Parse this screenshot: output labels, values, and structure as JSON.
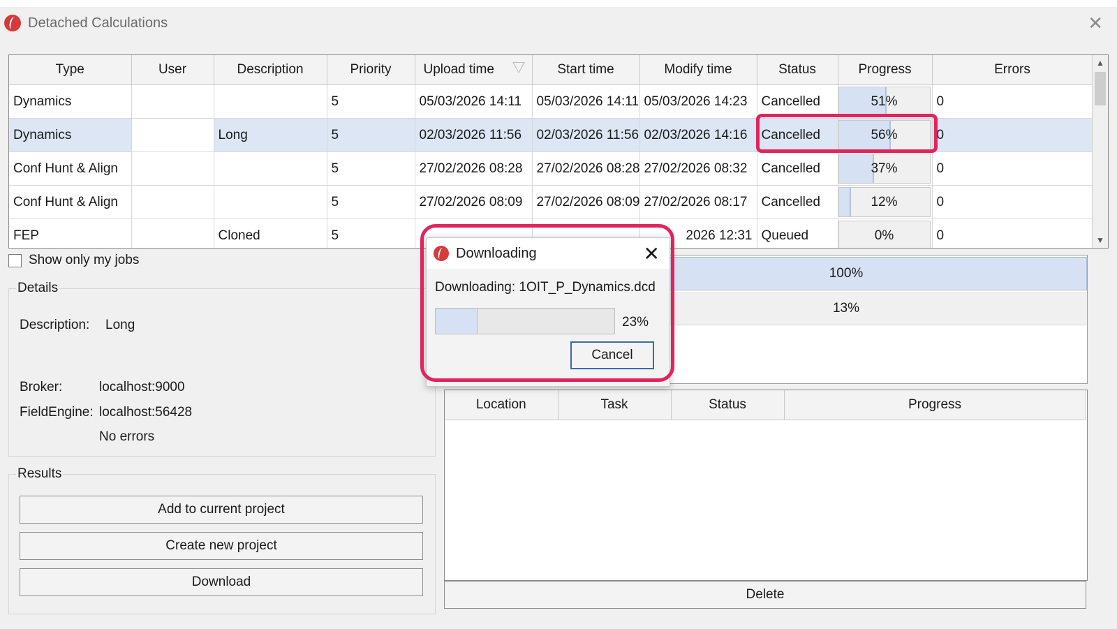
{
  "window": {
    "title": "Detached Calculations",
    "close_glyph": "✕"
  },
  "grid": {
    "columns": [
      "Type",
      "User",
      "Description",
      "Priority",
      "Upload time",
      "Start time",
      "Modify time",
      "Status",
      "Progress",
      "Errors"
    ],
    "rows": [
      {
        "type": "Dynamics",
        "user": "",
        "description": "",
        "priority": "5",
        "upload": "05/03/2026 14:11",
        "start": "05/03/2026 14:11",
        "modify": "05/03/2026 14:23",
        "status": "Cancelled",
        "progress_label": "51%",
        "progress": 51,
        "errors": "0"
      },
      {
        "type": "Dynamics",
        "user": "",
        "description": "Long",
        "priority": "5",
        "upload": "02/03/2026 11:56",
        "start": "02/03/2026 11:56",
        "modify": "02/03/2026 14:16",
        "status": "Cancelled",
        "progress_label": "56%",
        "progress": 56,
        "errors": "0"
      },
      {
        "type": "Conf Hunt & Align",
        "user": "",
        "description": "",
        "priority": "5",
        "upload": "27/02/2026 08:28",
        "start": "27/02/2026 08:28",
        "modify": "27/02/2026 08:32",
        "status": "Cancelled",
        "progress_label": "37%",
        "progress": 37,
        "errors": "0"
      },
      {
        "type": "Conf Hunt & Align",
        "user": "",
        "description": "",
        "priority": "5",
        "upload": "27/02/2026 08:09",
        "start": "27/02/2026 08:09",
        "modify": "27/02/2026 08:17",
        "status": "Cancelled",
        "progress_label": "12%",
        "progress": 12,
        "errors": "0"
      },
      {
        "type": "FEP",
        "user": "",
        "description": "Cloned",
        "priority": "5",
        "upload": "",
        "start": "",
        "modify": "2026 12:31",
        "status": "Queued",
        "progress_label": "0%",
        "progress": 0,
        "errors": "0"
      }
    ]
  },
  "filter": {
    "show_only_my_jobs": "Show only my jobs"
  },
  "details": {
    "legend": "Details",
    "description_label": "Description:",
    "description_value": "Long",
    "broker_label": "Broker:",
    "broker_value": "localhost:9000",
    "fieldengine_label": "FieldEngine:",
    "fieldengine_value": "localhost:56428",
    "errors_value": "No errors"
  },
  "results": {
    "legend": "Results",
    "add_label": "Add to current project",
    "create_label": "Create new project",
    "download_label": "Download"
  },
  "right_progress": {
    "row1": "100%",
    "row2": "13%"
  },
  "tasks": {
    "columns": [
      "Location",
      "Task",
      "Status",
      "Progress"
    ]
  },
  "delete_label": "Delete",
  "dialog": {
    "title": "Downloading",
    "message": "Downloading: 1OIT_P_Dynamics.dcd",
    "progress_label": "23%",
    "progress": 23,
    "cancel_label": "Cancel",
    "close_glyph": "✕"
  },
  "colors": {
    "highlight": "#e0245e",
    "selection": "#dce6f4",
    "progress_fill": "#d6e2f3"
  }
}
